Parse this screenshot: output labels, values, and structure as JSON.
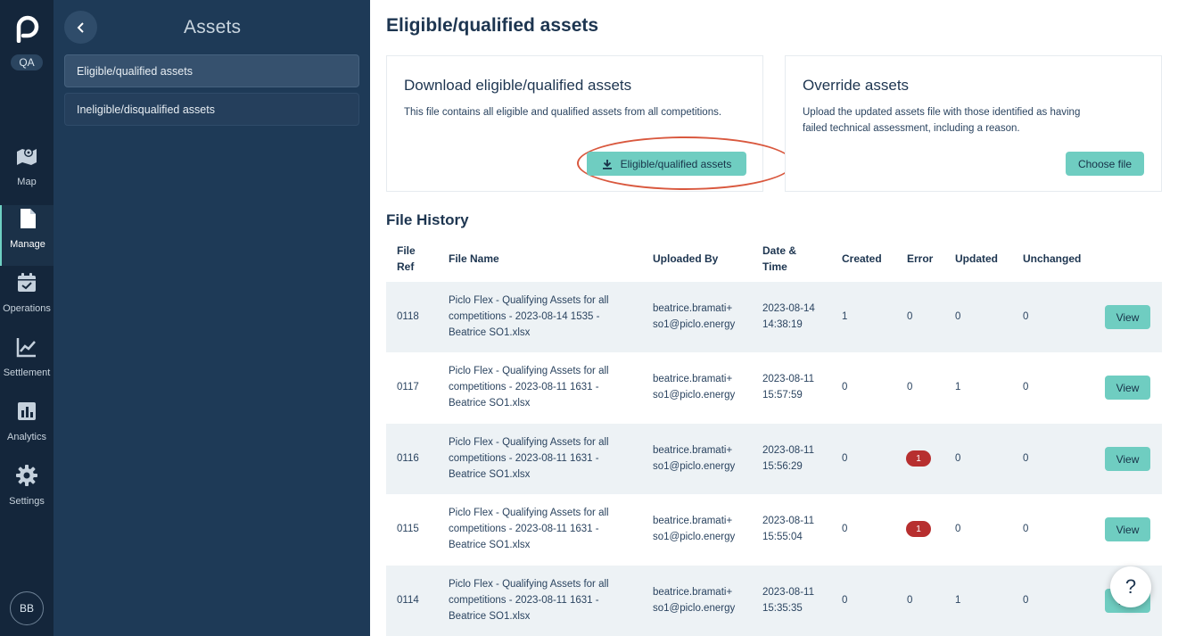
{
  "rail": {
    "env_badge": "QA",
    "items": [
      {
        "label": "Map",
        "icon": "map-icon"
      },
      {
        "label": "Manage",
        "icon": "document-icon",
        "active": true
      },
      {
        "label": "Operations",
        "icon": "calendar-check-icon"
      },
      {
        "label": "Settlement",
        "icon": "line-chart-icon"
      },
      {
        "label": "Analytics",
        "icon": "bar-chart-icon"
      },
      {
        "label": "Settings",
        "icon": "gear-icon"
      }
    ],
    "avatar": "BB"
  },
  "subnav": {
    "title": "Assets",
    "items": [
      {
        "label": "Eligible/qualified assets",
        "active": true
      },
      {
        "label": "Ineligible/disqualified assets",
        "active": false
      }
    ]
  },
  "main": {
    "title": "Eligible/qualified assets",
    "download_card": {
      "title": "Download eligible/qualified assets",
      "text": "This file contains all eligible and qualified assets from all competitions.",
      "button": "Eligible/qualified assets"
    },
    "override_card": {
      "title": "Override assets",
      "text_line1": "Upload the updated assets file with those identified as having",
      "text_line2": "failed technical assessment, including a reason.",
      "button": "Choose file"
    },
    "history": {
      "title": "File History",
      "columns": {
        "file_ref_1": "File",
        "file_ref_2": "Ref",
        "file_name": "File Name",
        "uploaded_by": "Uploaded By",
        "date_1": "Date &",
        "date_2": "Time",
        "created": "Created",
        "error": "Error",
        "updated": "Updated",
        "unchanged": "Unchanged"
      },
      "view_label": "View",
      "rows": [
        {
          "ref": "0118",
          "name1": "Piclo Flex - Qualifying Assets for all",
          "name2": "competitions - 2023-08-14 1535 -",
          "name3": "Beatrice SO1.xlsx",
          "user1": "beatrice.bramati+",
          "user2": "so1@piclo.energy",
          "date": "2023-08-14",
          "time": "14:38:19",
          "created": "1",
          "error": "0",
          "error_badge": false,
          "updated": "0",
          "unchanged": "0"
        },
        {
          "ref": "0117",
          "name1": "Piclo Flex - Qualifying Assets for all",
          "name2": "competitions - 2023-08-11 1631 -",
          "name3": "Beatrice SO1.xlsx",
          "user1": "beatrice.bramati+",
          "user2": "so1@piclo.energy",
          "date": "2023-08-11",
          "time": "15:57:59",
          "created": "0",
          "error": "0",
          "error_badge": false,
          "updated": "1",
          "unchanged": "0"
        },
        {
          "ref": "0116",
          "name1": "Piclo Flex - Qualifying Assets for all",
          "name2": "competitions - 2023-08-11 1631 -",
          "name3": "Beatrice SO1.xlsx",
          "user1": "beatrice.bramati+",
          "user2": "so1@piclo.energy",
          "date": "2023-08-11",
          "time": "15:56:29",
          "created": "0",
          "error": "1",
          "error_badge": true,
          "updated": "0",
          "unchanged": "0"
        },
        {
          "ref": "0115",
          "name1": "Piclo Flex - Qualifying Assets for all",
          "name2": "competitions - 2023-08-11 1631 -",
          "name3": "Beatrice SO1.xlsx",
          "user1": "beatrice.bramati+",
          "user2": "so1@piclo.energy",
          "date": "2023-08-11",
          "time": "15:55:04",
          "created": "0",
          "error": "1",
          "error_badge": true,
          "updated": "0",
          "unchanged": "0"
        },
        {
          "ref": "0114",
          "name1": "Piclo Flex - Qualifying Assets for all",
          "name2": "competitions - 2023-08-11 1631 -",
          "name3": "Beatrice SO1.xlsx",
          "user1": "beatrice.bramati+",
          "user2": "so1@piclo.energy",
          "date": "2023-08-11",
          "time": "15:35:35",
          "created": "0",
          "error": "0",
          "error_badge": false,
          "updated": "1",
          "unchanged": "0"
        }
      ]
    },
    "help": "?"
  }
}
